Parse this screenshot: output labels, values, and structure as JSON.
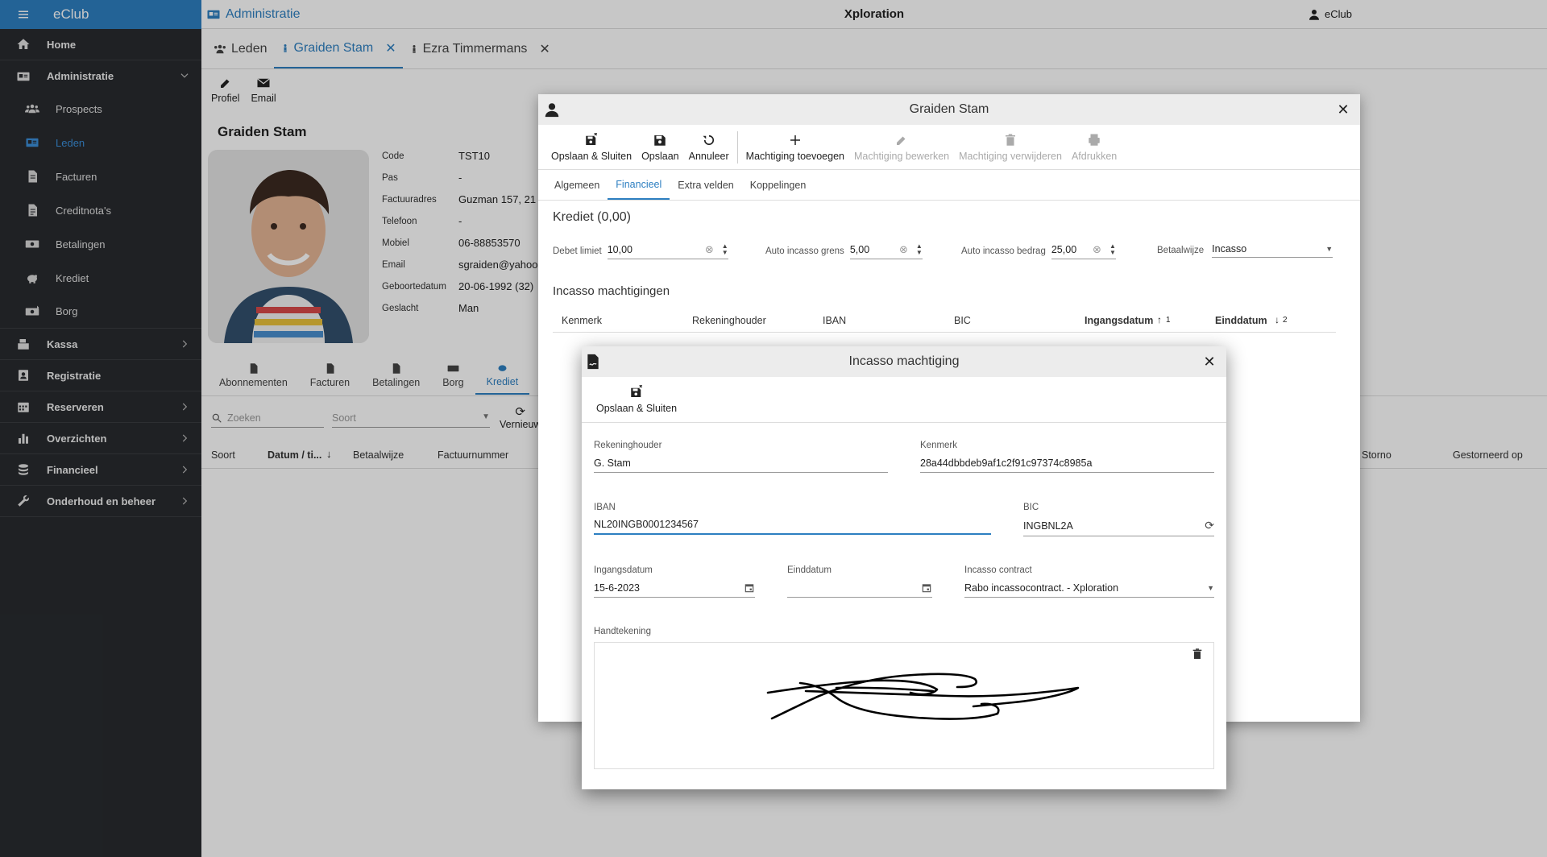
{
  "sidebar": {
    "brand": "eClub",
    "items": [
      {
        "label": "Home",
        "icon": "home-icon"
      },
      {
        "label": "Administratie",
        "icon": "id-card-icon",
        "expanded": true,
        "children": [
          {
            "label": "Prospects",
            "icon": "group-icon"
          },
          {
            "label": "Leden",
            "icon": "id-badge-icon",
            "active": true
          },
          {
            "label": "Facturen",
            "icon": "invoice-icon"
          },
          {
            "label": "Creditnota's",
            "icon": "credit-note-icon"
          },
          {
            "label": "Betalingen",
            "icon": "money-icon"
          },
          {
            "label": "Krediet",
            "icon": "piggy-bank-icon"
          },
          {
            "label": "Borg",
            "icon": "deposit-icon"
          }
        ]
      },
      {
        "label": "Kassa",
        "icon": "cash-register-icon"
      },
      {
        "label": "Registratie",
        "icon": "registration-icon"
      },
      {
        "label": "Reserveren",
        "icon": "calendar-icon"
      },
      {
        "label": "Overzichten",
        "icon": "bar-chart-icon"
      },
      {
        "label": "Financieel",
        "icon": "coins-icon"
      },
      {
        "label": "Onderhoud en beheer",
        "icon": "wrench-icon"
      }
    ]
  },
  "topbar": {
    "module": "Administratie",
    "app": "Xploration",
    "user": "eClub"
  },
  "tabs": [
    {
      "label": "Leden"
    },
    {
      "label": "Graiden Stam",
      "active": true
    },
    {
      "label": "Ezra Timmermans"
    }
  ],
  "toolbar": {
    "profiel": "Profiel",
    "email": "Email"
  },
  "member": {
    "name": "Graiden Stam",
    "fields": [
      {
        "label": "Code",
        "value": "TST10"
      },
      {
        "label": "Pas",
        "value": "-"
      },
      {
        "label": "Factuuradres",
        "value": "Guzman 157, 21"
      },
      {
        "label": "Telefoon",
        "value": "-"
      },
      {
        "label": "Mobiel",
        "value": "06-88853570"
      },
      {
        "label": "Email",
        "value": "sgraiden@yahoo"
      },
      {
        "label": "Geboortedatum",
        "value": "20-06-1992 (32)"
      },
      {
        "label": "Geslacht",
        "value": "Man"
      }
    ],
    "subtabs": [
      "Abonnementen",
      "Facturen",
      "Betalingen",
      "Borg",
      "Krediet"
    ],
    "search_placeholder": "Zoeken",
    "sort_placeholder": "Soort",
    "refresh_label": "Vernieuw",
    "table_headers": [
      "Soort",
      "Datum / ti...",
      "Betaalwijze",
      "Factuurnummer"
    ],
    "table_headers_right": [
      "Storno",
      "Gestorneerd op"
    ]
  },
  "dialog1": {
    "title": "Graiden Stam",
    "toolbar": [
      {
        "label": "Opslaan & Sluiten",
        "disabled": false
      },
      {
        "label": "Opslaan",
        "disabled": false
      },
      {
        "label": "Annuleer",
        "disabled": false
      },
      {
        "label": "Machtiging toevoegen",
        "disabled": false
      },
      {
        "label": "Machtiging bewerken",
        "disabled": true
      },
      {
        "label": "Machtiging verwijderen",
        "disabled": true
      },
      {
        "label": "Afdrukken",
        "disabled": true
      }
    ],
    "tabs": [
      "Algemeen",
      "Financieel",
      "Extra velden",
      "Koppelingen"
    ],
    "active_tab": "Financieel",
    "krediet_title": "Krediet (0,00)",
    "fields": {
      "debet_limiet": {
        "label": "Debet limiet",
        "value": "10,00"
      },
      "auto_incasso_grens": {
        "label": "Auto incasso grens",
        "value": "5,00"
      },
      "auto_incasso_bedrag": {
        "label": "Auto incasso bedrag",
        "value": "25,00"
      },
      "betaalwijze": {
        "label": "Betaalwijze",
        "value": "Incasso"
      }
    },
    "machtigingen_title": "Incasso machtigingen",
    "table_headers": [
      "Kenmerk",
      "Rekeninghouder",
      "IBAN",
      "BIC",
      "Ingangsdatum",
      "Einddatum"
    ],
    "sort_ingangsdatum": "1",
    "sort_einddatum": "2"
  },
  "dialog2": {
    "title": "Incasso machtiging",
    "save_close": "Opslaan & Sluiten",
    "fields": {
      "rekeninghouder": {
        "label": "Rekeninghouder",
        "value": "G. Stam"
      },
      "kenmerk": {
        "label": "Kenmerk",
        "value": "28a44dbbdeb9af1c2f91c97374c8985a"
      },
      "iban": {
        "label": "IBAN",
        "value": "NL20INGB0001234567"
      },
      "bic": {
        "label": "BIC",
        "value": "INGBNL2A"
      },
      "ingangsdatum": {
        "label": "Ingangsdatum",
        "value": "15-6-2023"
      },
      "einddatum": {
        "label": "Einddatum",
        "value": ""
      },
      "incasso_contract": {
        "label": "Incasso contract",
        "value": "Rabo incassocontract. - Xploration"
      }
    },
    "handtekening_label": "Handtekening"
  }
}
